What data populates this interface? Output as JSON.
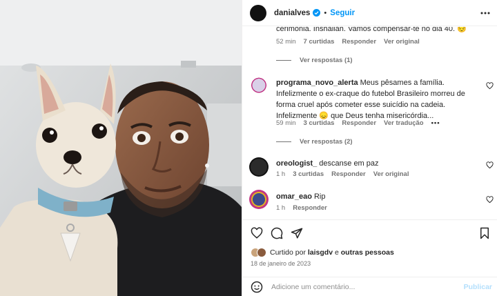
{
  "header": {
    "username": "danialves",
    "separator": "•",
    "follow_label": "Seguir",
    "avatar_color": "#111111"
  },
  "comments": [
    {
      "text": "cerimônia. Inshallah. Vamos compensar-te no dia 40. 😔",
      "time": "52 min",
      "likes": "7 curtidas",
      "reply": "Responder",
      "extra": "Ver original",
      "replies_label": "Ver respostas (1)"
    },
    {
      "username": "programa_novo_alerta",
      "text": "Meus pêsames a família. Infelizmente o ex-craque do futebol Brasileiro morreu de forma cruel após cometer esse suicídio na cadeia. Infelizmente 😞 que Deus tenha misericórdia...",
      "time": "59 min",
      "likes": "3 curtidas",
      "reply": "Responder",
      "extra": "Ver tradução",
      "more": "•••",
      "replies_label": "Ver respostas (2)"
    },
    {
      "username": "oreologist_",
      "text": "descanse em paz",
      "time": "1 h",
      "likes": "3 curtidas",
      "reply": "Responder",
      "extra": "Ver original"
    },
    {
      "username": "omar_eao",
      "text": "Rip",
      "time": "1 h",
      "reply": "Responder"
    }
  ],
  "footer": {
    "liked_prefix": "Curtido por",
    "liked_user": "laisgdv",
    "liked_join": "e",
    "liked_others": "outras pessoas",
    "date": "18 de janeiro de 2023",
    "comment_placeholder": "Adicione um comentário...",
    "post_label": "Publicar"
  },
  "colors": {
    "accent": "#0095f6",
    "verified": "#0095f6",
    "muted": "#737373"
  },
  "icons": [
    "verified-badge-icon",
    "more-options-icon",
    "heart-icon",
    "comment-icon",
    "share-icon",
    "bookmark-icon",
    "emoji-icon"
  ]
}
